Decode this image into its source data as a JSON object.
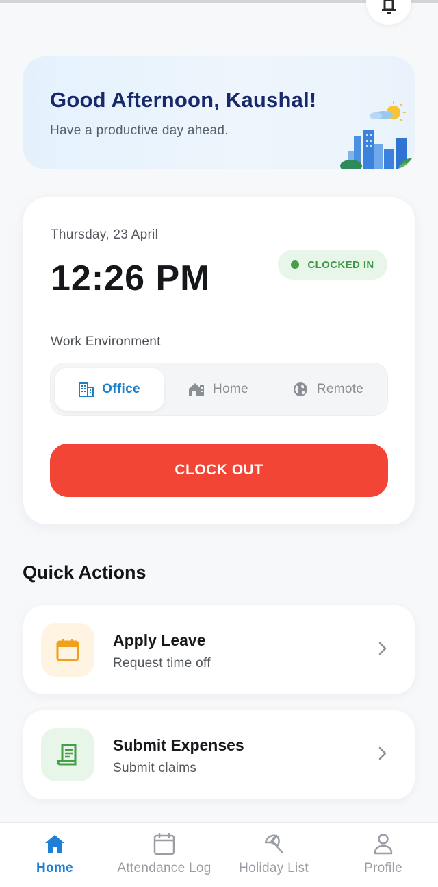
{
  "greeting": {
    "title": "Good Afternoon, Kaushal!",
    "subtitle": "Have a productive day ahead."
  },
  "clock": {
    "date": "Thursday, 23 April",
    "time": "12:26 PM",
    "status": "CLOCKED IN",
    "status_color": "#43a047",
    "env_label": "Work Environment",
    "env_options": [
      {
        "label": "Office",
        "icon": "building-icon",
        "selected": true
      },
      {
        "label": "Home",
        "icon": "house-icon",
        "selected": false
      },
      {
        "label": "Remote",
        "icon": "globe-icon",
        "selected": false
      }
    ],
    "button_label": "CLOCK OUT",
    "button_color": "#f34536"
  },
  "quick_actions": {
    "title": "Quick Actions",
    "items": [
      {
        "title": "Apply Leave",
        "subtitle": "Request time off",
        "icon": "calendar-icon",
        "accent": "#f0a01a"
      },
      {
        "title": "Submit Expenses",
        "subtitle": "Submit claims",
        "icon": "receipt-icon",
        "accent": "#43a047"
      }
    ]
  },
  "nav": {
    "items": [
      {
        "label": "Home",
        "icon": "home-icon",
        "active": true
      },
      {
        "label": "Attendance Log",
        "icon": "calendar-icon",
        "active": false
      },
      {
        "label": "Holiday List",
        "icon": "beach-umbrella-icon",
        "active": false
      },
      {
        "label": "Profile",
        "icon": "person-icon",
        "active": false
      }
    ],
    "active_color": "#1e7fd6"
  }
}
